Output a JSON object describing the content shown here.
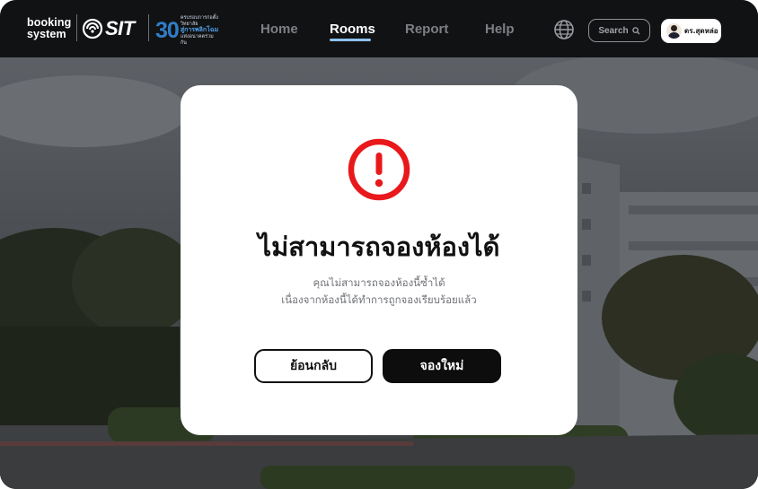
{
  "brand": {
    "line1": "booking",
    "line2": "system"
  },
  "logos": {
    "sit": "SIT",
    "anniversary_number": "30",
    "anniversary_line1": "ครบรอบการก่อตั้งวิทยาลัย",
    "anniversary_line2": "สู่การพลิกโฉม",
    "anniversary_line3": "แห่งอนาคตร่วมกัน"
  },
  "nav": {
    "items": [
      {
        "label": "Home",
        "active": false
      },
      {
        "label": "Rooms",
        "active": true
      },
      {
        "label": "Report",
        "active": false
      },
      {
        "label": "Help",
        "active": false
      }
    ],
    "language_icon": "globe-icon",
    "search_label": "Search",
    "search_icon": "search-icon",
    "user_name": "ดร.สุดหล่อ"
  },
  "modal": {
    "icon": "alert-icon",
    "icon_color": "#e8181b",
    "title": "ไม่สามารถจองห้องได้",
    "message_line1": "คุณไม่สามารถจองห้องนี้ซ้ำได้",
    "message_line2": "เนื่องจากห้องนี้ได้ทำการถูกจองเรียบร้อยแล้ว",
    "back_button": "ย้อนกลับ",
    "rebook_button": "จองใหม่"
  },
  "colors": {
    "navbar": "#111214",
    "active_underline": "#8ec1ee",
    "primary_button": "#0d0d0d",
    "alert": "#e8181b"
  }
}
